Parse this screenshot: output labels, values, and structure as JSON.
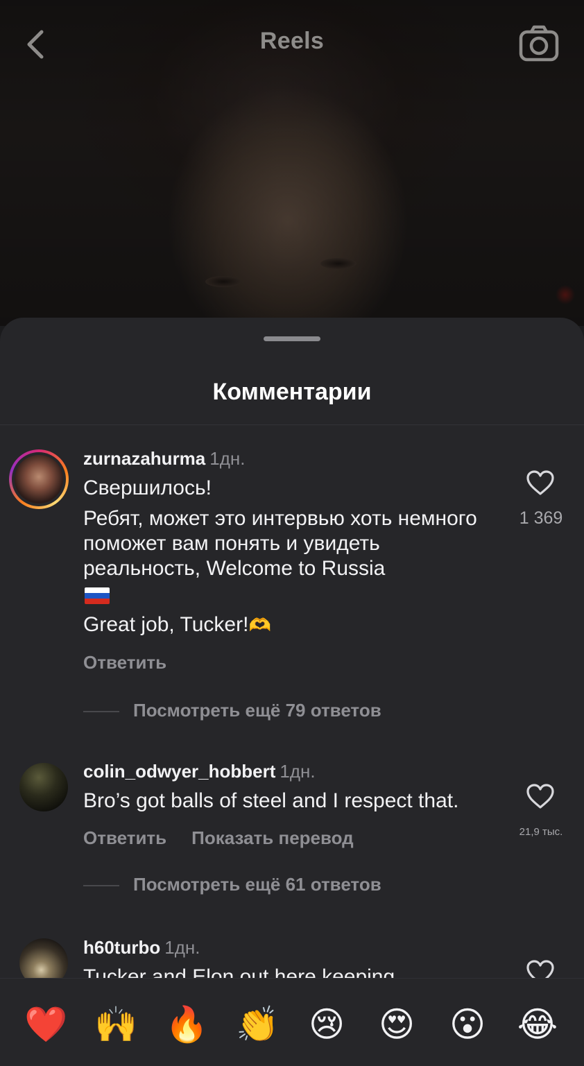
{
  "header": {
    "title": "Reels",
    "back_icon": "chevron-left-icon",
    "camera_icon": "camera-icon"
  },
  "sheet": {
    "title": "Комментарии"
  },
  "comments": [
    {
      "username": "zurnazahurma",
      "time": "1дн.",
      "lines": [
        "Свершилось!",
        "Ребят, может это интервью хоть немного поможет вам понять и увидеть реальность, Welcome to Russia",
        "Great job, Tucker!"
      ],
      "likes": "1 369",
      "reply_label": "Ответить",
      "view_replies": "Посмотреть ещё 79 ответов"
    },
    {
      "username": "colin_odwyer_hobbert",
      "time": "1дн.",
      "lines": [
        "Bro’s got balls of steel and I respect that."
      ],
      "likes": "21,9 тыс.",
      "reply_label": "Ответить",
      "translate_label": "Показать перевод",
      "view_replies": "Посмотреть ещё 61 ответов"
    },
    {
      "username": "h60turbo",
      "time": "1дн.",
      "lines": [
        "Tucker and Elon out here keeping"
      ]
    }
  ],
  "emoji_bar": {
    "emojis": [
      "❤️",
      "🙌",
      "🔥",
      "👏",
      "😢",
      "😍",
      "😮",
      "😂"
    ]
  },
  "colors": {
    "sheet_bg": "#262629",
    "text_primary": "#f2f2f4",
    "text_secondary": "#8f8f94"
  }
}
